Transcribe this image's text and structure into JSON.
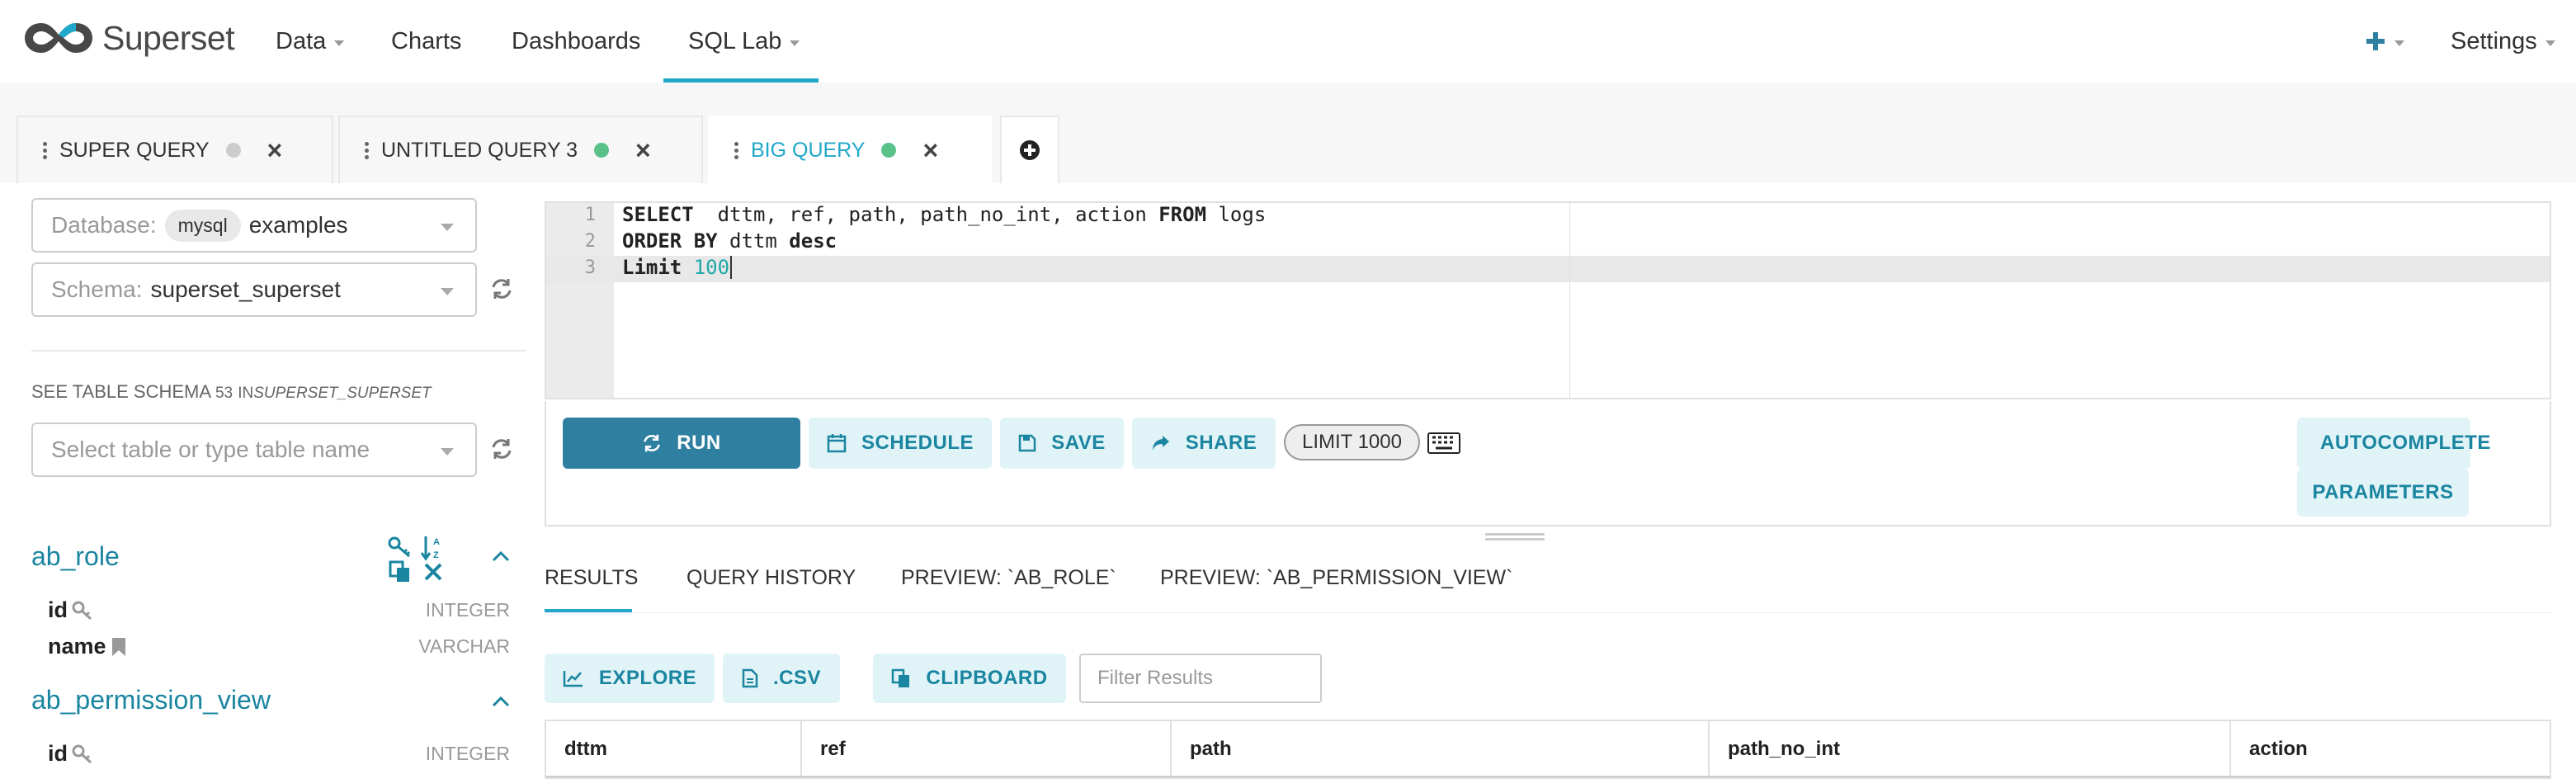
{
  "navbar": {
    "brand": "Superset",
    "menu": [
      {
        "label": "Data",
        "has_caret": true
      },
      {
        "label": "Charts",
        "has_caret": false
      },
      {
        "label": "Dashboards",
        "has_caret": false
      },
      {
        "label": "SQL Lab",
        "has_caret": true,
        "active": true
      }
    ],
    "settings_label": "Settings"
  },
  "query_tabs": [
    {
      "label": "SUPER QUERY",
      "status_color": "#cccccc",
      "active": false
    },
    {
      "label": "UNTITLED QUERY 3",
      "status_color": "#5ac189",
      "active": false
    },
    {
      "label": "BIG QUERY",
      "status_color": "#5ac189",
      "active": true
    }
  ],
  "left_panel": {
    "database_label": "Database:",
    "database_engine": "mysql",
    "database_value": "examples",
    "schema_label": "Schema:",
    "schema_value": "superset_superset",
    "see_schema_text": "SEE TABLE SCHEMA",
    "table_count": "53",
    "in_text": "IN",
    "schema_name": "SUPERSET_SUPERSET",
    "table_select_placeholder": "Select table or type table name",
    "tables": [
      {
        "name": "ab_role",
        "columns": [
          {
            "name": "id",
            "type": "INTEGER",
            "icon": "key-icon"
          },
          {
            "name": "name",
            "type": "VARCHAR",
            "icon": "bookmark-icon"
          }
        ]
      },
      {
        "name": "ab_permission_view",
        "columns": [
          {
            "name": "id",
            "type": "INTEGER",
            "icon": "key-icon"
          }
        ]
      }
    ]
  },
  "editor": {
    "line_numbers": [
      "1",
      "2",
      "3"
    ],
    "line1": {
      "kw1": "SELECT",
      "rest": "  dttm, ref, path, path_no_int, action ",
      "kw2": "FROM",
      "tail": " logs"
    },
    "line2": {
      "kw1": "ORDER BY",
      "mid": " dttm ",
      "kw2": "desc"
    },
    "line3": {
      "kw1": "Limit",
      "num": " 100"
    }
  },
  "actions": {
    "run": "RUN",
    "schedule": "SCHEDULE",
    "save": "SAVE",
    "share": "SHARE",
    "limit": "LIMIT 1000",
    "autocomplete": "AUTOCOMPLETE",
    "parameters": "PARAMETERS"
  },
  "result_tabs": [
    {
      "label": "RESULTS",
      "active": true
    },
    {
      "label": "QUERY HISTORY",
      "active": false
    },
    {
      "label": "PREVIEW: `AB_ROLE`",
      "active": false
    },
    {
      "label": "PREVIEW: `AB_PERMISSION_VIEW`",
      "active": false
    }
  ],
  "result_actions": {
    "explore": "EXPLORE",
    "csv": ".CSV",
    "clipboard": "CLIPBOARD",
    "filter_placeholder": "Filter Results"
  },
  "table_headers": [
    "dttm",
    "ref",
    "path",
    "path_no_int",
    "action"
  ],
  "colors": {
    "accent": "#20a7c9",
    "primary_button": "#2e7fa0",
    "status_success": "#5ac189",
    "status_idle": "#cccccc"
  }
}
